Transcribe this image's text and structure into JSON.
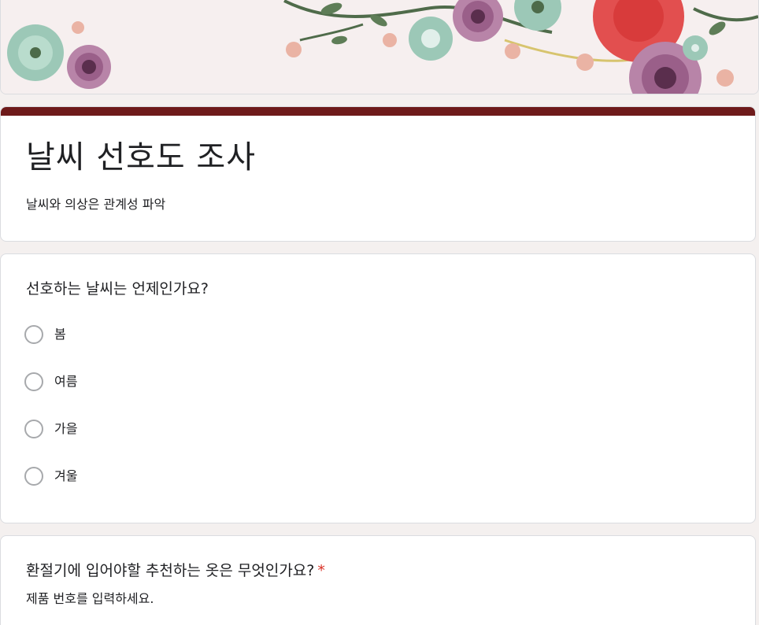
{
  "header": {
    "image": "floral-banner"
  },
  "form": {
    "title": "날씨 선호도 조사",
    "description": "날씨와 의상은 관계성 파악",
    "accent_color": "#6e1a1a"
  },
  "questions": [
    {
      "title": "선호하는 날씨는 언제인가요?",
      "required": false,
      "type": "radio",
      "options": [
        "봄",
        "여름",
        "가을",
        "겨울"
      ]
    },
    {
      "title": "환절기에 입어야할 추천하는 옷은 무엇인가요?",
      "required": true,
      "required_mark": "*",
      "description": "제품 번호를 입력하세요."
    }
  ]
}
